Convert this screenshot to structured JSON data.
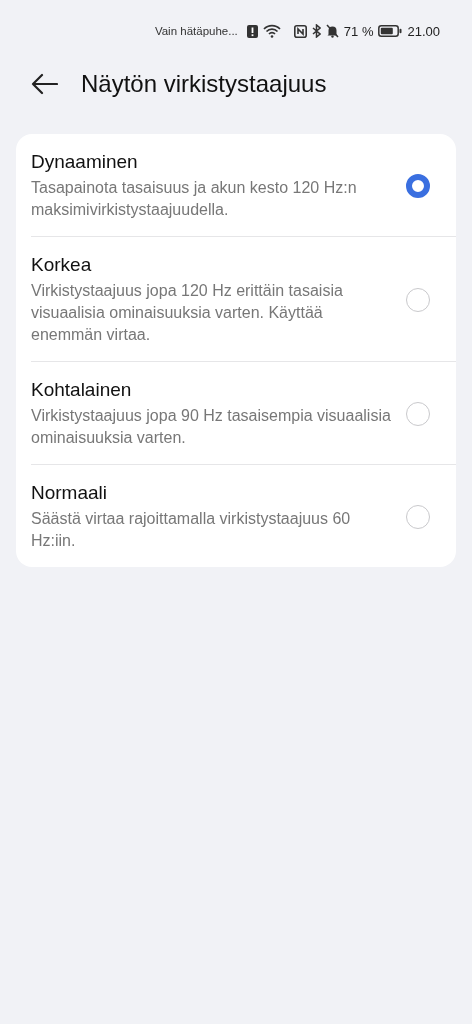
{
  "status_bar": {
    "carrier": "Vain hätäpuhe...",
    "battery_percent": "71 %",
    "time": "21.00"
  },
  "header": {
    "title": "Näytön virkistystaajuus"
  },
  "options": [
    {
      "title": "Dynaaminen",
      "description": "Tasapainota tasaisuus ja akun kesto 120 Hz:n maksimivirkistystaajuudella.",
      "selected": true
    },
    {
      "title": "Korkea",
      "description": "Virkistystaajuus jopa 120 Hz erittäin tasaisia visuaalisia ominaisuuksia varten. Käyttää enemmän virtaa.",
      "selected": false
    },
    {
      "title": "Kohtalainen",
      "description": "Virkistystaajuus jopa 90 Hz tasaisempia visuaalisia ominaisuuksia varten.",
      "selected": false
    },
    {
      "title": "Normaali",
      "description": "Säästä virtaa rajoittamalla virkistystaajuus 60 Hz:iin.",
      "selected": false
    }
  ]
}
